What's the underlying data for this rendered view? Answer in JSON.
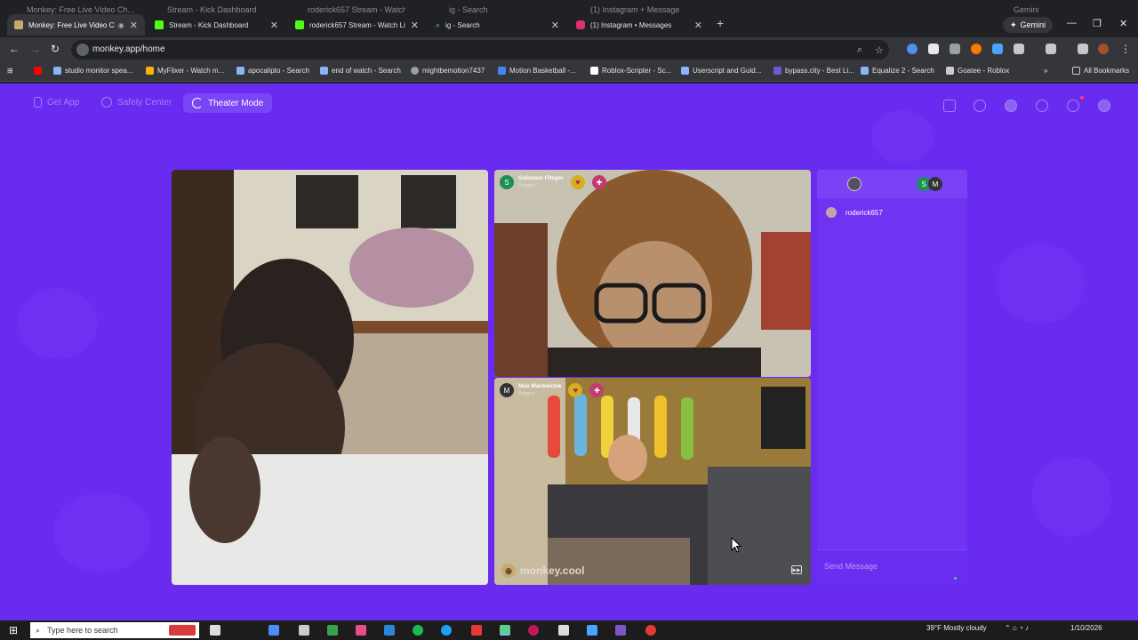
{
  "browser": {
    "ghost_tabs": [
      "Monkey: Free Live Video Ch...",
      "Stream - Kick Dashboard",
      "roderick657 Stream - Watch Li...",
      "ig - Search",
      "(1) Instagram + Messages",
      "Gemini"
    ],
    "tabs": [
      {
        "title": "Monkey: Free Live Video Ch",
        "active": true,
        "icon": "monkey-icon",
        "color": "#caa86b"
      },
      {
        "title": "Stream - Kick Dashboard",
        "active": false,
        "icon": "kick-icon",
        "color": "#53fc18"
      },
      {
        "title": "roderick657 Stream - Watch Liv",
        "active": false,
        "icon": "kick-icon",
        "color": "#53fc18"
      },
      {
        "title": "ig - Search",
        "active": false,
        "icon": "search-icon",
        "color": "#8ab4f8"
      },
      {
        "title": "(1) Instagram • Messages",
        "active": false,
        "icon": "instagram-icon",
        "color": "#e1306c"
      }
    ],
    "gemini_label": "Gemini",
    "url": "monkey.app/home",
    "bookmarks": [
      {
        "label": "studio monitor spea...",
        "color": "#8ab4f8"
      },
      {
        "label": "MyFlixer - Watch m...",
        "color": "#f4b400"
      },
      {
        "label": "apocalipto - Search",
        "color": "#8ab4f8"
      },
      {
        "label": "end of watch - Search",
        "color": "#8ab4f8"
      },
      {
        "label": "mightbemotion7437",
        "color": "#9aa0a6"
      },
      {
        "label": "Motion Basketball -...",
        "color": "#4285f4"
      },
      {
        "label": "Roblox-Scripter - Sc...",
        "color": "#ffffff"
      },
      {
        "label": "Userscript and Guid...",
        "color": "#8ab4f8"
      },
      {
        "label": "bypass.city - Best Li...",
        "color": "#6a5acd"
      },
      {
        "label": "Equalize 2 - Search",
        "color": "#8ab4f8"
      },
      {
        "label": "Goatee - Roblox",
        "color": "#cccccc"
      }
    ],
    "all_bookmarks_label": "All Bookmarks"
  },
  "app": {
    "nav": {
      "get_app": "Get App",
      "safety_center": "Safety Center",
      "theater_mode": "Theater Mode"
    },
    "videos": {
      "top": {
        "user": "Solomon Fitzger",
        "level": "Dragon",
        "avatar_letter": "S",
        "avatar_color": "#1b8f54"
      },
      "bottom": {
        "user": "Max Mackenziw",
        "level": "Dragon",
        "avatar_letter": "M",
        "avatar_color": "#333333"
      },
      "watermark": "monkey.cool"
    },
    "chat": {
      "header_avatars": [
        "S",
        "M"
      ],
      "user": "roderick657",
      "input_placeholder": "Send Message"
    }
  },
  "taskbar": {
    "search_placeholder": "Type here to search",
    "weather": "39°F  Mostly cloudy",
    "date": "1/10/2026"
  }
}
